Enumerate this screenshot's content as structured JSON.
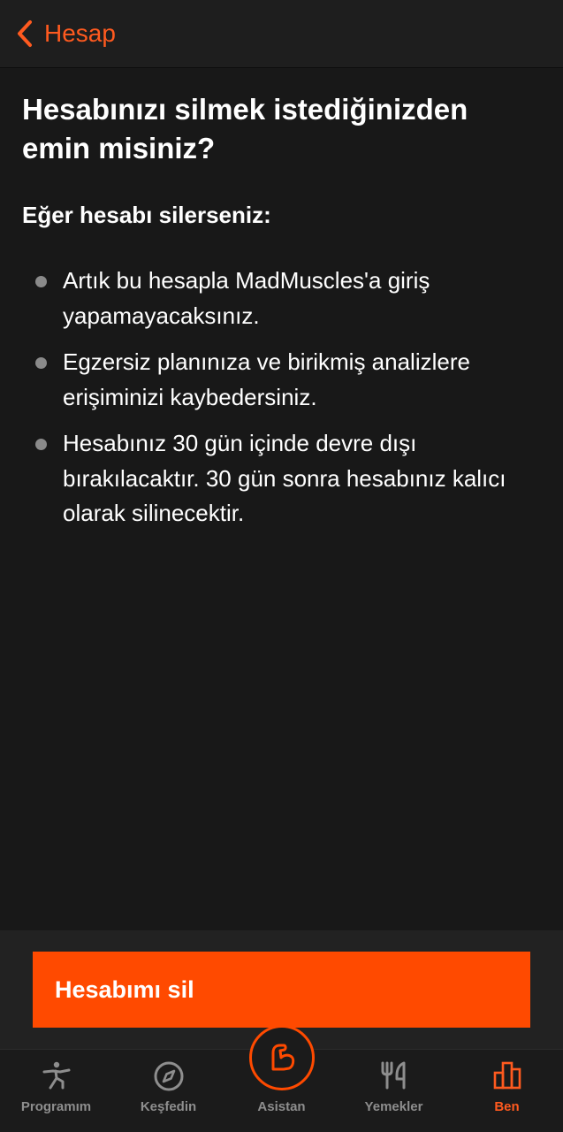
{
  "navbar": {
    "back_label": "Hesap",
    "back_icon": "chevron-left-icon"
  },
  "content": {
    "title": "Hesabınızı silmek istediğinizden emin misiniz?",
    "subtitle": "Eğer hesabı silerseniz:",
    "bullets": [
      "Artık bu hesapla MadMuscles'a giriş yapamayacaksınız.",
      "Egzersiz planınıza ve birikmiş analizlere erişiminizi kaybedersiniz.",
      "Hesabınız 30 gün içinde devre dışı bırakılacaktır. 30 gün sonra hesabınız kalıcı olarak silinecektir."
    ]
  },
  "action": {
    "delete_label": "Hesabımı sil"
  },
  "tabbar": {
    "tabs": [
      {
        "label": "Programım",
        "icon": "stretching-person-icon",
        "active": false
      },
      {
        "label": "Keşfedin",
        "icon": "compass-icon",
        "active": false
      },
      {
        "label": "Asistan",
        "icon": "flexed-arm-icon",
        "active": false
      },
      {
        "label": "Yemekler",
        "icon": "fork-knife-icon",
        "active": false
      },
      {
        "label": "Ben",
        "icon": "bar-chart-icon",
        "active": true
      }
    ]
  },
  "colors": {
    "accent": "#ff5a1f",
    "button": "#ff4a00",
    "background": "#181818",
    "inactive_tab": "#8e8e8e"
  }
}
